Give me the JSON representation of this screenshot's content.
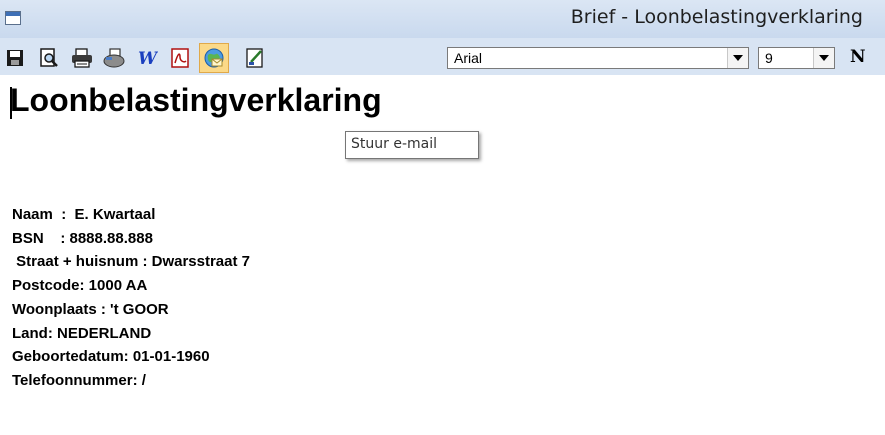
{
  "window": {
    "title": "Brief - Loonbelastingverklaring"
  },
  "toolbar": {
    "buttons": [
      {
        "name": "save-icon",
        "active": false
      },
      {
        "name": "print-preview-icon",
        "active": false
      },
      {
        "name": "printer-icon",
        "active": false
      },
      {
        "name": "fax-icon",
        "active": false
      },
      {
        "name": "word-icon",
        "active": false
      },
      {
        "name": "pdf-icon",
        "active": false
      },
      {
        "name": "email-globe-icon",
        "active": true
      },
      {
        "name": "edit-document-icon",
        "active": false
      }
    ],
    "font_name": "Arial",
    "font_size": "9",
    "bold_label": "N"
  },
  "tooltip": {
    "text": "Stuur e-mail"
  },
  "document": {
    "heading": "Loonbelastingverklaring",
    "fields": [
      "Naam  :  E. Kwartaal",
      "BSN    : 8888.88.888",
      " Straat + huisnum : Dwarsstraat 7",
      "Postcode: 1000 AA",
      "Woonplaats : 't GOOR",
      "Land: NEDERLAND",
      "Geboortedatum: 01-01-1960",
      "Telefoonnummer: /"
    ]
  },
  "colors": {
    "titlebar": "#dbe6f4",
    "toolbar": "#d8e4f3",
    "active_button": "#fbd988"
  }
}
